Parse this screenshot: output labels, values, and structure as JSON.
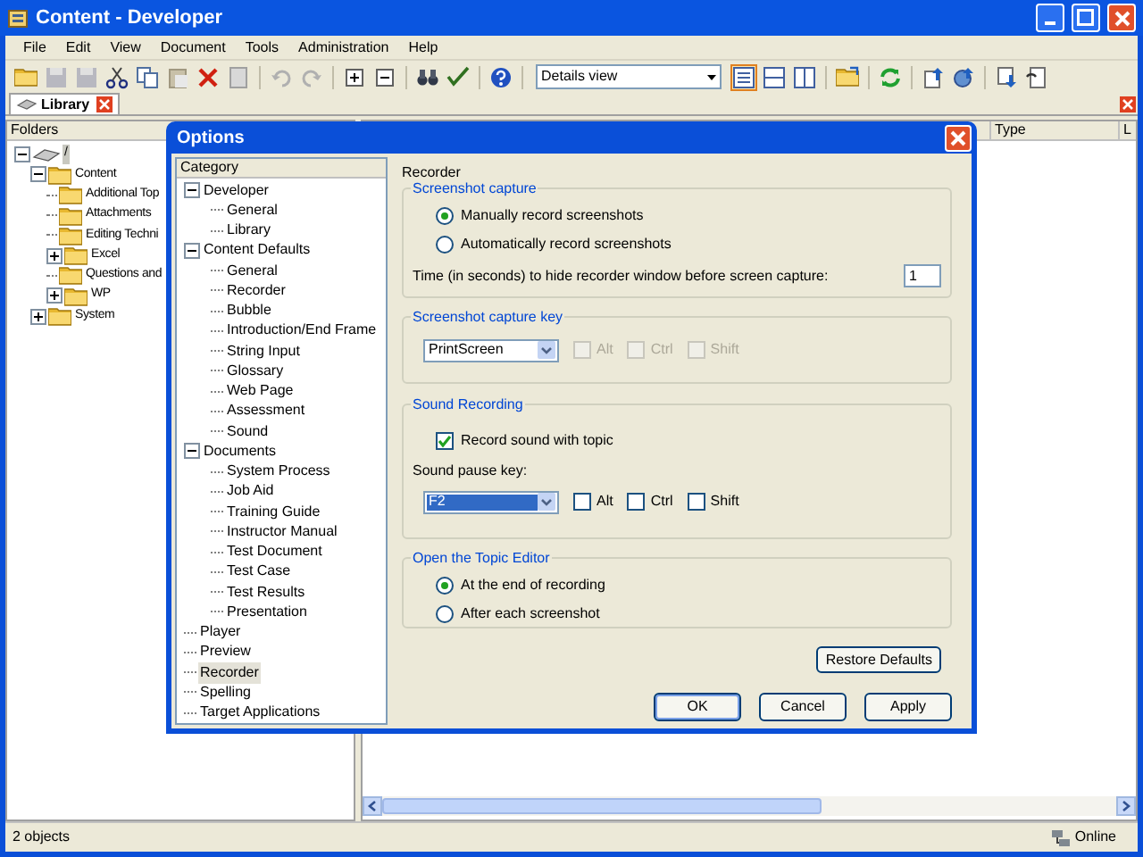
{
  "window": {
    "title": "Content - Developer"
  },
  "menu": [
    "File",
    "Edit",
    "View",
    "Document",
    "Tools",
    "Administration",
    "Help"
  ],
  "toolbar": {
    "view_select": "Details view"
  },
  "tabs": [
    {
      "label": "Library",
      "selected": true
    }
  ],
  "folders": {
    "header": "Folders",
    "tree": [
      {
        "label": "/",
        "selected": true,
        "expanded": true,
        "children": [
          {
            "label": "Content",
            "selected": false,
            "expanded": true,
            "children": [
              {
                "label": "Additional Top",
                "selected": false
              },
              {
                "label": "Attachments",
                "selected": false
              },
              {
                "label": "Editing Techni",
                "selected": false
              },
              {
                "label": "Excel",
                "selected": false,
                "expanded": false
              },
              {
                "label": "Questions and",
                "selected": false
              },
              {
                "label": "WP",
                "selected": false,
                "expanded": false
              }
            ]
          },
          {
            "label": "System",
            "selected": false,
            "expanded": false
          }
        ]
      }
    ]
  },
  "list": {
    "columns": [
      "Type",
      "L"
    ]
  },
  "status_bar": {
    "text": "2 objects",
    "connection": "Online"
  },
  "dialog": {
    "title": "Options",
    "category_header": "Category",
    "page_title": "Recorder",
    "categories": [
      {
        "label": "Developer",
        "selected": false,
        "expanded": true,
        "children": [
          {
            "label": "General",
            "selected": false
          },
          {
            "label": "Library",
            "selected": false
          }
        ]
      },
      {
        "label": "Content Defaults",
        "selected": false,
        "expanded": true,
        "children": [
          {
            "label": "General",
            "selected": false
          },
          {
            "label": "Recorder",
            "selected": false
          },
          {
            "label": "Bubble",
            "selected": false
          },
          {
            "label": "Introduction/End Frame",
            "selected": false
          },
          {
            "label": "String Input",
            "selected": false
          },
          {
            "label": "Glossary",
            "selected": false
          },
          {
            "label": "Web Page",
            "selected": false
          },
          {
            "label": "Assessment",
            "selected": false
          },
          {
            "label": "Sound",
            "selected": false
          }
        ]
      },
      {
        "label": "Documents",
        "selected": false,
        "expanded": true,
        "children": [
          {
            "label": "System Process",
            "selected": false
          },
          {
            "label": "Job Aid",
            "selected": false
          },
          {
            "label": "Training Guide",
            "selected": false
          },
          {
            "label": "Instructor Manual",
            "selected": false
          },
          {
            "label": "Test Document",
            "selected": false
          },
          {
            "label": "Test Case",
            "selected": false
          },
          {
            "label": "Test Results",
            "selected": false
          },
          {
            "label": "Presentation",
            "selected": false
          }
        ]
      },
      {
        "label": "Player",
        "selected": false
      },
      {
        "label": "Preview",
        "selected": false
      },
      {
        "label": "Recorder",
        "selected": true
      },
      {
        "label": "Spelling",
        "selected": false
      },
      {
        "label": "Target Applications",
        "selected": false
      }
    ],
    "groups": [
      {
        "title": "Screenshot capture",
        "items": [
          {
            "kind": "radio",
            "label": "Manually record screenshots",
            "selected": true
          },
          {
            "kind": "radio",
            "label": "Automatically record screenshots",
            "selected": false
          },
          {
            "kind": "number",
            "label": "Time (in seconds) to hide recorder window before screen capture:",
            "value": "1"
          }
        ]
      },
      {
        "title": "Screenshot capture key",
        "items": [
          {
            "kind": "keyselect",
            "value": "PrintScreen",
            "highlighted": false,
            "modifiers": [
              {
                "label": "Alt",
                "checked": false,
                "disabled": true
              },
              {
                "label": "Ctrl",
                "checked": false,
                "disabled": true
              },
              {
                "label": "Shift",
                "checked": false,
                "disabled": true
              }
            ]
          }
        ]
      },
      {
        "title": "Sound Recording",
        "items": [
          {
            "kind": "checkbox",
            "label": "Record sound with topic",
            "checked": true
          },
          {
            "kind": "label",
            "label": "Sound pause key:"
          },
          {
            "kind": "keyselect",
            "value": "F2",
            "highlighted": true,
            "modifiers": [
              {
                "label": "Alt",
                "checked": false,
                "disabled": false
              },
              {
                "label": "Ctrl",
                "checked": false,
                "disabled": false
              },
              {
                "label": "Shift",
                "checked": false,
                "disabled": false
              }
            ]
          }
        ]
      },
      {
        "title": "Open the Topic Editor",
        "items": [
          {
            "kind": "radio",
            "label": "At the end of recording",
            "selected": true
          },
          {
            "kind": "radio",
            "label": "After each screenshot",
            "selected": false
          }
        ]
      }
    ],
    "restore_button": "Restore Defaults",
    "buttons": [
      {
        "label": "OK",
        "default": true
      },
      {
        "label": "Cancel",
        "default": false
      },
      {
        "label": "Apply",
        "default": false
      }
    ]
  }
}
